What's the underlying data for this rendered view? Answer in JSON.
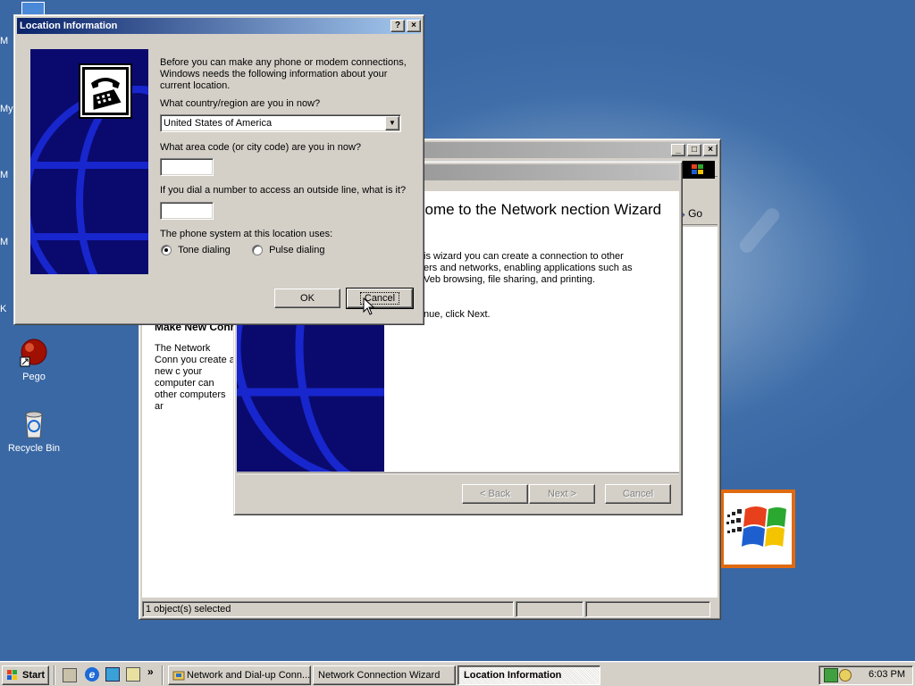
{
  "desktop": {
    "edge_labels": [
      "M",
      "My",
      "M",
      "M",
      "K"
    ],
    "icons": [
      {
        "label": "Pego",
        "icon": "pego-icon"
      },
      {
        "label": "Recycle Bin",
        "icon": "recycle-bin-icon"
      }
    ]
  },
  "explorer": {
    "section_heading": "Make New Conn",
    "description": "The Network Conn you create a new c your computer can other computers ar",
    "go_label": "Go",
    "status_text": "1 object(s) selected"
  },
  "wizard": {
    "heading": "come to the Network nection Wizard",
    "intro": "is wizard you can create a connection to other ers and networks, enabling applications such as Veb browsing, file sharing, and printing.",
    "continue": "nue, click Next.",
    "back_label": "< Back",
    "next_label": "Next >",
    "cancel_label": "Cancel"
  },
  "dialog": {
    "title": "Location Information",
    "intro": "Before you can make any phone or modem connections, Windows needs the following information about your current location.",
    "country_label": "What country/region are you in now?",
    "country_value": "United States of America",
    "area_code_label": "What area code (or city code) are you in now?",
    "area_code_value": "",
    "outside_line_label": "If you dial a number to access an outside line, what is it?",
    "outside_line_value": "",
    "phone_system_label": "The phone system at this location uses:",
    "tone_label": "Tone dialing",
    "pulse_label": "Pulse dialing",
    "selected_dialing": "tone",
    "ok_label": "OK",
    "cancel_label": "Cancel",
    "help_btn": "?",
    "close_btn": "×"
  },
  "taskbar": {
    "start_label": "Start",
    "chevron": "»",
    "tasks": [
      {
        "label": "Network and Dial-up Conn...",
        "icon": "network-folder-icon"
      },
      {
        "label": "Network Connection Wizard",
        "icon": ""
      },
      {
        "label": "Location Information",
        "icon": ""
      }
    ],
    "clock": "6:03 PM"
  },
  "colors": {
    "desktop": "#3a68a4",
    "title_active": "#0a246a",
    "title_inactive": "#808080",
    "face": "#d4d0c8",
    "sidebar": "#0a0a6e"
  }
}
